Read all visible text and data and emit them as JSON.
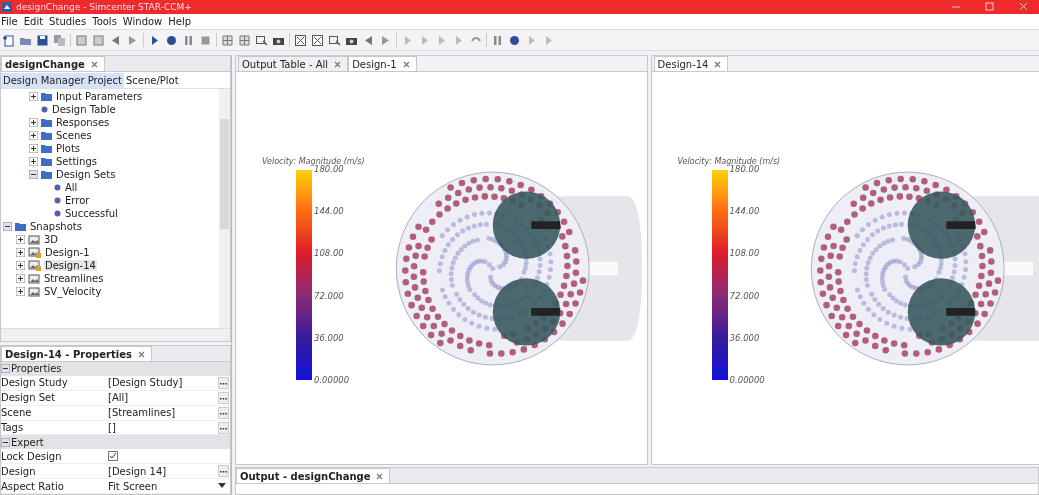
{
  "window": {
    "title": "designChange - Simcenter STAR-CCM+"
  },
  "menu": [
    "File",
    "Edit",
    "Studies",
    "Tools",
    "Window",
    "Help"
  ],
  "tree_panel": {
    "tab": "designChange",
    "subtabs": [
      {
        "label": "Design Manager Project",
        "selected": true
      },
      {
        "label": "Scene/Plot",
        "selected": false
      }
    ],
    "tree_upper_children": [
      {
        "label": "Input Parameters",
        "kind": "folder",
        "expanded": false,
        "selected": false
      },
      {
        "label": "Design Table",
        "kind": "dot",
        "selected": false
      },
      {
        "label": "Responses",
        "kind": "folder",
        "expanded": false,
        "selected": false
      },
      {
        "label": "Scenes",
        "kind": "folder",
        "expanded": false,
        "selected": false
      },
      {
        "label": "Plots",
        "kind": "folder",
        "expanded": false,
        "selected": false
      },
      {
        "label": "Settings",
        "kind": "folder",
        "expanded": false,
        "selected": false
      },
      {
        "label": "Design Sets",
        "kind": "folder",
        "expanded": true,
        "selected": false,
        "children": [
          {
            "label": "All",
            "kind": "dot",
            "selected": false
          },
          {
            "label": "Error",
            "kind": "dot",
            "selected": false
          },
          {
            "label": "Successful",
            "kind": "dot",
            "selected": false
          }
        ]
      }
    ],
    "tree": [
      {
        "label": "Snapshots",
        "kind": "folder",
        "expanded": true,
        "selected": false,
        "children": [
          {
            "label": "3D",
            "kind": "snapshot",
            "expanded": false,
            "selected": false
          },
          {
            "label": "Design-1",
            "kind": "locked-snapshot",
            "expanded": false,
            "selected": false
          },
          {
            "label": "Design-14",
            "kind": "locked-snapshot",
            "expanded": false,
            "selected": true
          },
          {
            "label": "Streamlines",
            "kind": "snapshot",
            "expanded": false,
            "selected": false
          },
          {
            "label": "SV_Velocity",
            "kind": "snapshot",
            "expanded": false,
            "selected": false
          }
        ]
      }
    ]
  },
  "properties_panel": {
    "tab": "Design-14 - Properties",
    "groups": [
      {
        "label": "Properties",
        "expanded": true,
        "rows": [
          {
            "name": "Design Study",
            "value": "[Design Study]",
            "kind": "text",
            "has_editor": true
          },
          {
            "name": "Design Set",
            "value": "[All]",
            "kind": "text",
            "has_editor": true
          },
          {
            "name": "Scene",
            "value": "[Streamlines]",
            "kind": "text",
            "has_editor": true
          },
          {
            "name": "Tags",
            "value": "[]",
            "kind": "text",
            "has_editor": true
          }
        ]
      },
      {
        "label": "Expert",
        "expanded": true,
        "rows": [
          {
            "name": "Lock Design",
            "kind": "checkbox",
            "checked": true
          },
          {
            "name": "Design",
            "value": "[Design 14]",
            "kind": "text",
            "has_editor": true
          },
          {
            "name": "Aspect Ratio",
            "value": "Fit Screen",
            "kind": "dropdown"
          }
        ]
      }
    ]
  },
  "viewers": [
    {
      "tabs": [
        {
          "label": "Output Table - All",
          "selected": false
        },
        {
          "label": "Design-1",
          "selected": true
        }
      ],
      "legend": {
        "title": "Velocity: Magnitude (m/s)",
        "ticks": [
          "180.00",
          "144.00",
          "108.00",
          "72.000",
          "36.000",
          "0.00000"
        ]
      }
    },
    {
      "tabs": [
        {
          "label": "Design-14",
          "selected": true
        }
      ],
      "legend": {
        "title": "Velocity: Magnitude (m/s)",
        "ticks": [
          "180.00",
          "144.00",
          "108.00",
          "72.000",
          "36.000",
          "0.00000"
        ]
      }
    }
  ],
  "output_panel": {
    "tab": "Output - designChange"
  }
}
